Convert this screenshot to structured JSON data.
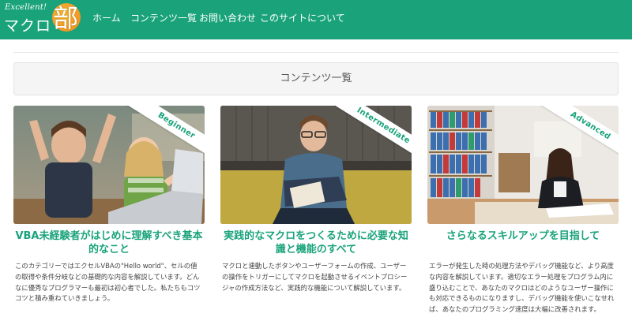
{
  "logo": {
    "small": "Excellent!",
    "main": "マクロ",
    "kanji": "部"
  },
  "nav": {
    "items": [
      "ホーム",
      "コンテンツ一覧",
      "お問い合わせ",
      "このサイトについて"
    ]
  },
  "section": {
    "heading": "コンテンツ一覧"
  },
  "cards": [
    {
      "badge": "Beginner",
      "title": "VBA未経験者がはじめに理解すべき基本的なこと",
      "text": "このカテゴリーではエクセルVBAの\"Hello world\"、セルの値の取得や条件分岐などの基礎的な内容を解説しています。どんなに優秀なプログラマーも最初は初心者でした。私たちもコツコツと積み重ねていきましょう。"
    },
    {
      "badge": "Intermediate",
      "title": "実践的なマクロをつくるために必要な知識と機能のすべて",
      "text": "マクロと連動したボタンやユーザーフォームの作成、ユーザーの操作をトリガーにしてマクロを起動させるイベントプロシージャの作成方法など、実践的な機能について解説しています。"
    },
    {
      "badge": "Advanced",
      "title": "さらなるスキルアップを目指して",
      "text": "エラーが発生した時の処理方法やデバッグ機能など、より高度な内容を解説しています。適切なエラー処理をプログラム内に盛り込むことで、あなたのマクロはどのようなユーザー操作にも対応できるものになりますし、デバッグ機能を使いこなせれば、あなたのプログラミング速度は大幅に改善されます。"
    }
  ],
  "colors": {
    "brand": "#1aa37a",
    "logo_accent": "#f2a12a"
  }
}
